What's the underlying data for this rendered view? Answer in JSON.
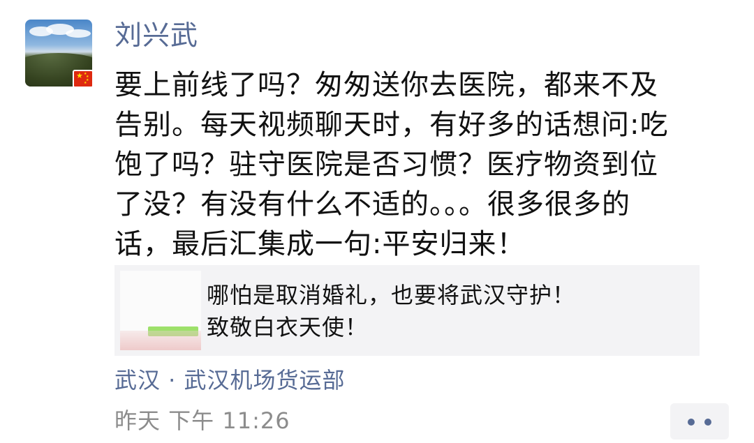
{
  "post": {
    "author_name": "刘兴武",
    "text_lines": [
      "要上前线了吗？匆匆送你去医院，都来不及",
      "告别。每天视频聊天时，有好多的话想问:吃",
      "饱了吗？驻守医院是否习惯？医疗物资到位",
      "了没？有没有什么不适的。。。很多很多的",
      "话，最后汇集成一句:平安归来！"
    ],
    "avatar_icon": "landscape-avatar",
    "badge_icon": "china-flag-icon",
    "link_card": {
      "thumbnail_icon": "chat-screenshot-thumbnail",
      "title_lines": [
        "哪怕是取消婚礼，也要将武汉守护！",
        "致敬白衣天使！"
      ]
    },
    "location": "武汉 · 武汉机场货运部",
    "time": "昨天  下午 11:26",
    "more_icon": "more-dots-icon"
  },
  "colors": {
    "name": "#576b95",
    "text": "#111111",
    "time": "#8c8c8c",
    "card_bg": "#f3f3f5"
  }
}
